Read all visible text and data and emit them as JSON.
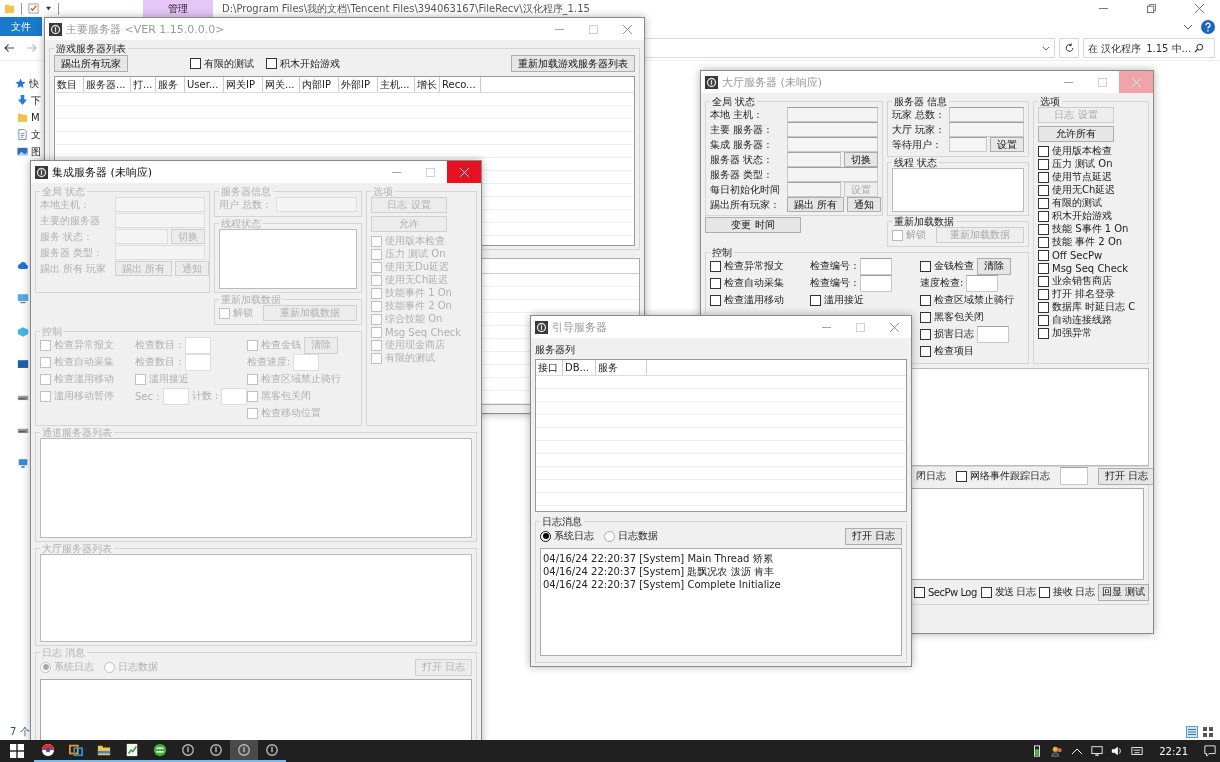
{
  "explorer": {
    "ribbon_tab": "管理",
    "path": "D:\\Program Files\\我的文档\\Tencent Files\\394063167\\FileRecv\\汉化程序_1.15",
    "file_tab": "文件",
    "search": {
      "placeholder": "在 汉化程序_1.15 中..."
    },
    "nav_items": [
      {
        "kind": "star",
        "label": "快"
      },
      {
        "kind": "download",
        "label": "下"
      },
      {
        "kind": "folder",
        "label": "M"
      },
      {
        "kind": "document",
        "label": "文"
      },
      {
        "kind": "image",
        "label": "图"
      }
    ],
    "status": "7 个"
  },
  "main_server": {
    "title": "主要服务器 <VER 1.15.0.0.0>",
    "active": false,
    "close_highlight": false,
    "group": "游戏服务器列表",
    "items": [
      {
        "kind": "button",
        "label": "踢出所有玩家"
      },
      {
        "kind": "checkbox",
        "label": "有限的测试",
        "checked": false
      },
      {
        "kind": "checkbox",
        "label": "积木开始游戏",
        "checked": false
      },
      {
        "kind": "button",
        "label": "重新加载游戏服务器列表"
      }
    ],
    "columns": [
      "数目",
      "服务器...",
      "打...",
      "服务",
      "User...",
      "网关IP",
      "网关...",
      "内部IP",
      "外部IP",
      "主机...",
      "增长",
      "Reco..."
    ]
  },
  "lobby_server": {
    "title": "大厅服务器 (未响应)",
    "active": false,
    "close_highlight": true,
    "global": {
      "title": "全局 状态",
      "rows": [
        [
          {
            "kind": "label",
            "text": "本地 主机 :"
          },
          {
            "kind": "field"
          }
        ],
        [
          {
            "kind": "label",
            "text": "主要 服务器 :"
          },
          {
            "kind": "field"
          }
        ],
        [
          {
            "kind": "label",
            "text": "集成 服务器 :"
          },
          {
            "kind": "field"
          }
        ],
        [
          {
            "kind": "label",
            "text": "服务器 状态 :"
          },
          {
            "kind": "field"
          },
          {
            "kind": "button",
            "label": "切换",
            "disabled": false
          }
        ],
        [
          {
            "kind": "label",
            "text": "服务器 类型 :"
          },
          {
            "kind": "field"
          }
        ],
        [
          {
            "kind": "label",
            "text": "每日初始化时间"
          },
          {
            "kind": "field"
          },
          {
            "kind": "button",
            "label": "设置",
            "disabled": true
          }
        ],
        [
          {
            "kind": "label",
            "text": "踢出所有玩家 :"
          },
          {
            "kind": "button",
            "label": "踢出 所有",
            "disabled": false
          },
          {
            "kind": "button",
            "label": "通知",
            "disabled": false
          }
        ]
      ]
    },
    "change_time": {
      "kind": "button",
      "label": "变更 时间",
      "disabled": false
    },
    "info": {
      "title": "服务器 信息",
      "rows": [
        [
          {
            "kind": "label",
            "text": "玩家 总数 :"
          },
          {
            "kind": "field"
          }
        ],
        [
          {
            "kind": "label",
            "text": "大厅 玩家 :"
          },
          {
            "kind": "field"
          }
        ],
        [
          {
            "kind": "label",
            "text": "等待用户 :"
          },
          {
            "kind": "field"
          },
          {
            "kind": "button",
            "label": "设置",
            "disabled": false
          }
        ]
      ]
    },
    "thread": {
      "title": "线程 状态"
    },
    "reload": {
      "title": "重新加载数据",
      "items": [
        {
          "kind": "checkbox",
          "label": "解锁",
          "checked": false,
          "disabled": true
        },
        {
          "kind": "button",
          "label": "重新加载数据",
          "disabled": true
        }
      ]
    },
    "options": {
      "title": "选项",
      "items": [
        {
          "kind": "button",
          "label": "日志 设置",
          "disabled": true
        },
        {
          "kind": "button",
          "label": "允许所有",
          "disabled": false
        },
        {
          "kind": "checkbox",
          "label": "使用版本检查",
          "checked": false,
          "disabled": false
        },
        {
          "kind": "checkbox",
          "label": "压力 测试 On",
          "checked": false,
          "disabled": false
        },
        {
          "kind": "checkbox",
          "label": "使用节点延迟",
          "checked": false,
          "disabled": false
        },
        {
          "kind": "checkbox",
          "label": "使用无Ch延迟",
          "checked": false,
          "disabled": false
        },
        {
          "kind": "checkbox",
          "label": "有限的测试",
          "checked": false,
          "disabled": false
        },
        {
          "kind": "checkbox",
          "label": "积木开始游戏",
          "checked": false,
          "disabled": false
        },
        {
          "kind": "checkbox",
          "label": "技能 S事件 1 On",
          "checked": false,
          "disabled": false
        },
        {
          "kind": "checkbox",
          "label": "技能 事件 2 On",
          "checked": false,
          "disabled": false
        },
        {
          "kind": "checkbox",
          "label": "Off SecPw",
          "checked": false,
          "disabled": false
        },
        {
          "kind": "checkbox",
          "label": "Msg Seq Check",
          "checked": false,
          "disabled": false
        },
        {
          "kind": "checkbox",
          "label": "业余销售商店",
          "checked": false,
          "disabled": false
        },
        {
          "kind": "checkbox",
          "label": "打开 排名登录",
          "checked": false,
          "disabled": false
        },
        {
          "kind": "checkbox",
          "label": "数据库 时延日志 C",
          "checked": false,
          "disabled": false
        },
        {
          "kind": "checkbox",
          "label": "自动连接线路",
          "checked": false,
          "disabled": false
        },
        {
          "kind": "checkbox",
          "label": "加强异常",
          "checked": false,
          "disabled": false
        }
      ]
    },
    "control": {
      "title": "控制",
      "columns": [
        [
          [
            {
              "kind": "checkbox",
              "label": "检查异常报文",
              "checked": false,
              "disabled": false
            }
          ],
          [
            {
              "kind": "checkbox",
              "label": "检查自动采集",
              "checked": false,
              "disabled": false
            }
          ],
          [
            {
              "kind": "checkbox",
              "label": "检查滥用移动",
              "checked": false,
              "disabled": false
            }
          ]
        ],
        [
          [
            {
              "kind": "label",
              "text": "检查编号 :"
            },
            {
              "kind": "field"
            }
          ],
          [
            {
              "kind": "label",
              "text": "检查编号 :"
            },
            {
              "kind": "field"
            }
          ],
          [
            {
              "kind": "checkbox",
              "label": "滥用接近",
              "checked": false,
              "disabled": false
            }
          ]
        ],
        [
          [
            {
              "kind": "checkbox",
              "label": "金钱检查",
              "checked": false,
              "disabled": false
            },
            {
              "kind": "button",
              "label": "清除",
              "disabled": false
            }
          ],
          [
            {
              "kind": "label",
              "text": "速度检查:"
            },
            {
              "kind": "field"
            }
          ],
          [
            {
              "kind": "checkbox",
              "label": "检查区域禁止骑行",
              "checked": false,
              "disabled": false
            }
          ],
          [
            {
              "kind": "checkbox",
              "label": "黑客包关闭",
              "checked": false,
              "disabled": false
            }
          ],
          [
            {
              "kind": "checkbox",
              "label": "损害日志",
              "checked": false,
              "disabled": false
            },
            {
              "kind": "field"
            }
          ],
          [
            {
              "kind": "checkbox",
              "label": "检查项目",
              "checked": false,
              "disabled": false
            }
          ]
        ]
      ]
    },
    "log": {
      "top": [
        {
          "kind": "label",
          "text": "闭日志"
        },
        {
          "kind": "checkbox",
          "label": "网络事件跟踪日志",
          "checked": false,
          "disabled": false
        },
        {
          "kind": "field"
        },
        {
          "kind": "button",
          "label": "打开 日志",
          "disabled": false
        }
      ],
      "bottom": [
        {
          "kind": "checkbox",
          "label": "SecPw Log",
          "checked": false,
          "disabled": false
        },
        {
          "kind": "checkbox",
          "label": "发送 日志",
          "checked": false,
          "disabled": false
        },
        {
          "kind": "checkbox",
          "label": "接收 日志",
          "checked": false,
          "disabled": false
        },
        {
          "kind": "button",
          "label": "回显 测试",
          "disabled": false
        }
      ]
    }
  },
  "integration_server": {
    "title": "集成服务器 (未响应)",
    "active": true,
    "close_highlight": true,
    "disabled": true,
    "global": {
      "title": "全局 状态",
      "rows": [
        [
          {
            "kind": "label",
            "text": "本地主机 :"
          },
          {
            "kind": "field"
          }
        ],
        [
          {
            "kind": "label",
            "text": "主要的服务器"
          },
          {
            "kind": "field"
          }
        ],
        [
          {
            "kind": "label",
            "text": "服务 状态 :"
          },
          {
            "kind": "field"
          },
          {
            "kind": "button",
            "label": "切换"
          }
        ],
        [
          {
            "kind": "label",
            "text": "服务器 类型 :"
          },
          {
            "kind": "field"
          }
        ],
        [
          {
            "kind": "label",
            "text": "踢出 所有 玩家"
          },
          {
            "kind": "button",
            "label": "踢出 所有"
          },
          {
            "kind": "button",
            "label": "通知"
          }
        ]
      ]
    },
    "info": {
      "title": "服务器信息",
      "rows": [
        [
          {
            "kind": "label",
            "text": "用户 总数 :"
          },
          {
            "kind": "field"
          }
        ]
      ]
    },
    "thread": {
      "title": "线程状态"
    },
    "reload": {
      "title": "重新加载数据",
      "items": [
        {
          "kind": "checkbox",
          "label": "解锁",
          "checked": false
        },
        {
          "kind": "button",
          "label": "重新加载数据"
        }
      ]
    },
    "options": {
      "title": "选项",
      "items": [
        {
          "kind": "button",
          "label": "日志 设置"
        },
        {
          "kind": "button",
          "label": "允许"
        },
        {
          "kind": "checkbox",
          "label": "使用版本检查",
          "checked": false
        },
        {
          "kind": "checkbox",
          "label": "压力 测试 On",
          "checked": false
        },
        {
          "kind": "checkbox",
          "label": "使用无Du延迟",
          "checked": false
        },
        {
          "kind": "checkbox",
          "label": "使用无Ch延迟",
          "checked": false
        },
        {
          "kind": "checkbox",
          "label": "技能事件 1 On",
          "checked": false
        },
        {
          "kind": "checkbox",
          "label": "技能事件 2 On",
          "checked": false
        },
        {
          "kind": "checkbox",
          "label": "综合技能 On",
          "checked": false
        },
        {
          "kind": "checkbox",
          "label": "Msg Seq Check",
          "checked": false
        },
        {
          "kind": "checkbox",
          "label": "使用现金商店",
          "checked": false
        },
        {
          "kind": "checkbox",
          "label": "有限的测试",
          "checked": false
        }
      ]
    },
    "control": {
      "title": "控制",
      "columns": [
        [
          [
            {
              "kind": "checkbox",
              "label": "检查异常报文",
              "checked": false
            }
          ],
          [
            {
              "kind": "checkbox",
              "label": "检查自动采集",
              "checked": false
            }
          ],
          [
            {
              "kind": "checkbox",
              "label": "检查滥用移动",
              "checked": false
            }
          ],
          [
            {
              "kind": "checkbox",
              "label": "滥用移动暂停",
              "checked": false
            }
          ]
        ],
        [
          [
            {
              "kind": "label",
              "text": "检查数目 :"
            },
            {
              "kind": "field"
            }
          ],
          [
            {
              "kind": "label",
              "text": "检查数目 :"
            },
            {
              "kind": "field"
            }
          ],
          [
            {
              "kind": "checkbox",
              "label": "滥用接近",
              "checked": false
            }
          ],
          [
            {
              "kind": "label",
              "text": "Sec :"
            },
            {
              "kind": "field"
            },
            {
              "kind": "label",
              "text": "计数 :"
            },
            {
              "kind": "field"
            }
          ]
        ],
        [
          [
            {
              "kind": "checkbox",
              "label": "检查金钱",
              "checked": false
            },
            {
              "kind": "button",
              "label": "清除"
            }
          ],
          [
            {
              "kind": "label",
              "text": "检查速度:"
            },
            {
              "kind": "field"
            }
          ],
          [
            {
              "kind": "checkbox",
              "label": "检查区域禁止骑行",
              "checked": false
            }
          ],
          [
            {
              "kind": "checkbox",
              "label": "黑客包关闭",
              "checked": false
            }
          ],
          [
            {
              "kind": "checkbox",
              "label": "检查移动位置",
              "checked": false
            }
          ]
        ]
      ]
    },
    "channel_list": {
      "title": "通道服务器列表"
    },
    "lobby_list": {
      "title": "大厅服务器列表"
    },
    "log": {
      "title": "日志 消息",
      "items": [
        {
          "kind": "radio",
          "label": "系统日志",
          "selected": true
        },
        {
          "kind": "radio",
          "label": "日志数据",
          "selected": false
        },
        {
          "kind": "button",
          "label": "打开 日志"
        }
      ]
    }
  },
  "guide_server": {
    "title": "引导服务器",
    "active": false,
    "close_highlight": false,
    "list_label": "服务器列",
    "columns": [
      "接口",
      "DB...",
      "服务"
    ],
    "log": {
      "title": "日志消息",
      "items": [
        {
          "kind": "radio",
          "label": "系统日志",
          "selected": true
        },
        {
          "kind": "radio",
          "label": "日志数据",
          "selected": false
        },
        {
          "kind": "button",
          "label": "打开 日志"
        }
      ],
      "lines": [
        "04/16/24 22:20:37 [System] Main Thread 矫累",
        "04/16/24 22:20:37 [System] 匙飘况农  泼沥  肯丰",
        "04/16/24 22:20:37 [System] Complete Initialize"
      ]
    }
  },
  "taskbar": {
    "apps": [
      {
        "kind": "browser",
        "selected": false
      },
      {
        "kind": "remote",
        "selected": false
      },
      {
        "kind": "folder",
        "selected": false
      },
      {
        "kind": "editor",
        "selected": false
      },
      {
        "kind": "green",
        "selected": false
      },
      {
        "kind": "server",
        "selected": false
      },
      {
        "kind": "server",
        "selected": false
      },
      {
        "kind": "server",
        "selected": true
      },
      {
        "kind": "server",
        "selected": false
      }
    ],
    "time": "22:21"
  }
}
